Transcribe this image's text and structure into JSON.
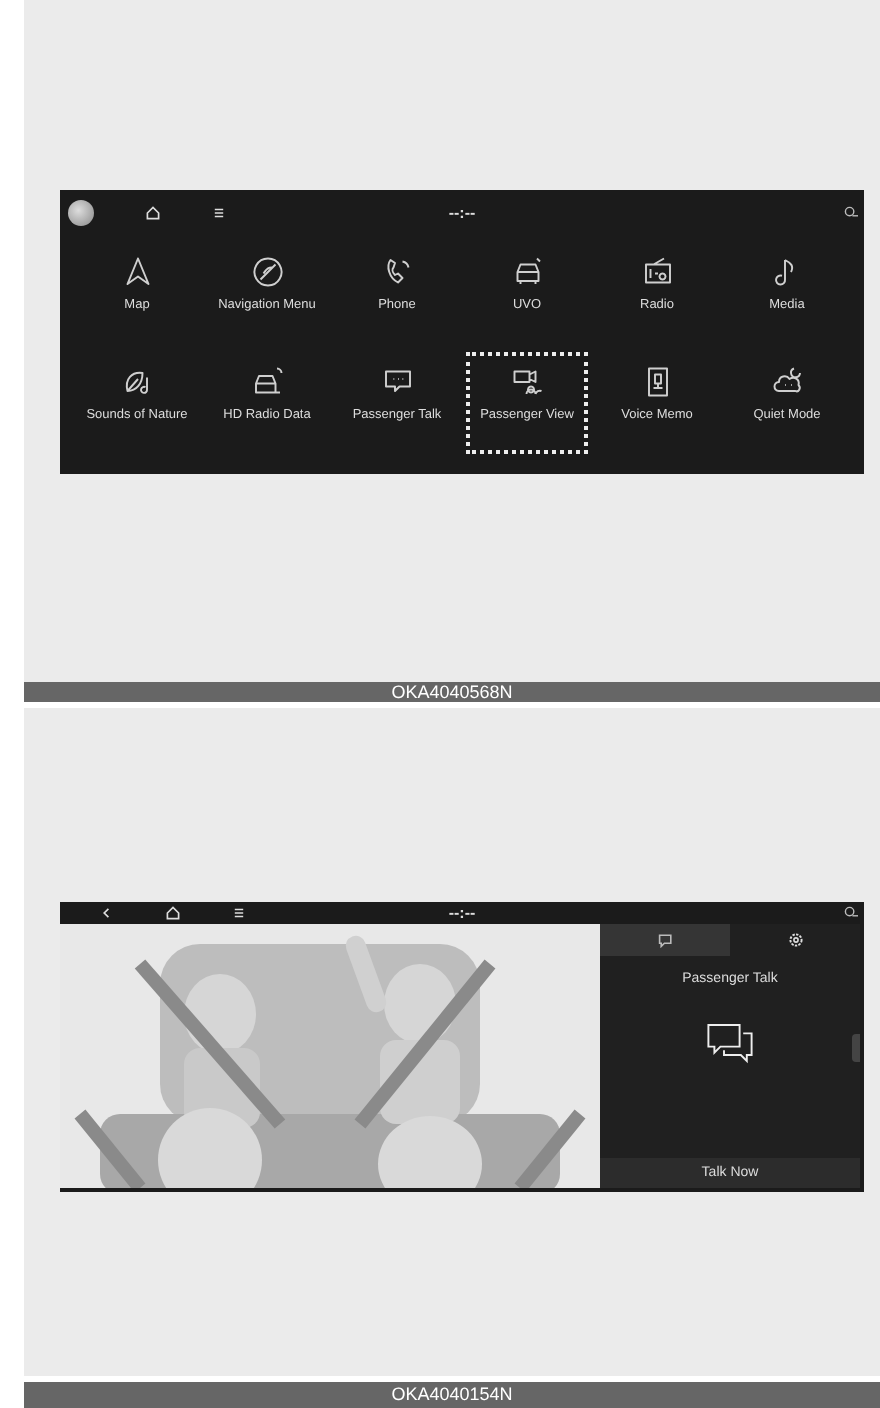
{
  "menu_screen": {
    "status_bar": {
      "clock": "--:--"
    },
    "apps": [
      {
        "label": "Map",
        "selected": false
      },
      {
        "label": "Navigation Menu",
        "selected": false
      },
      {
        "label": "Phone",
        "selected": false
      },
      {
        "label": "UVO",
        "selected": false
      },
      {
        "label": "Radio",
        "selected": false
      },
      {
        "label": "Media",
        "selected": false
      },
      {
        "label": "Sounds of Nature",
        "selected": false
      },
      {
        "label": "HD Radio Data",
        "selected": false
      },
      {
        "label": "Passenger Talk",
        "selected": false
      },
      {
        "label": "Passenger View",
        "selected": true
      },
      {
        "label": "Voice Memo",
        "selected": false
      },
      {
        "label": "Quiet Mode",
        "selected": false
      }
    ],
    "caption": "OKA4040568N"
  },
  "talk_screen": {
    "status_bar": {
      "clock": "--:--"
    },
    "panel": {
      "tabs": [
        {
          "kind": "chat",
          "selected": true
        },
        {
          "kind": "settings",
          "selected": false
        }
      ],
      "title": "Passenger Talk",
      "button": "Talk Now"
    },
    "caption": "OKA4040154N"
  }
}
